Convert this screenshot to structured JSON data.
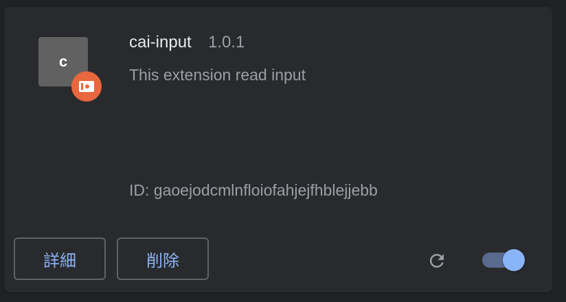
{
  "extension": {
    "icon_letter": "c",
    "name": "cai-input",
    "version": "1.0.1",
    "description": "This extension read input",
    "id_text": "ID: gaoejodcmlnfloiofahjejfhblejjebb",
    "enabled": true
  },
  "actions": {
    "details_label": "詳細",
    "remove_label": "削除"
  },
  "icons": {
    "badge": "unpacked-extension-icon",
    "reload": "reload-icon"
  },
  "colors": {
    "background": "#202124",
    "card": "#292a2d",
    "accent": "#8ab4f8",
    "badge": "#e8673e"
  }
}
